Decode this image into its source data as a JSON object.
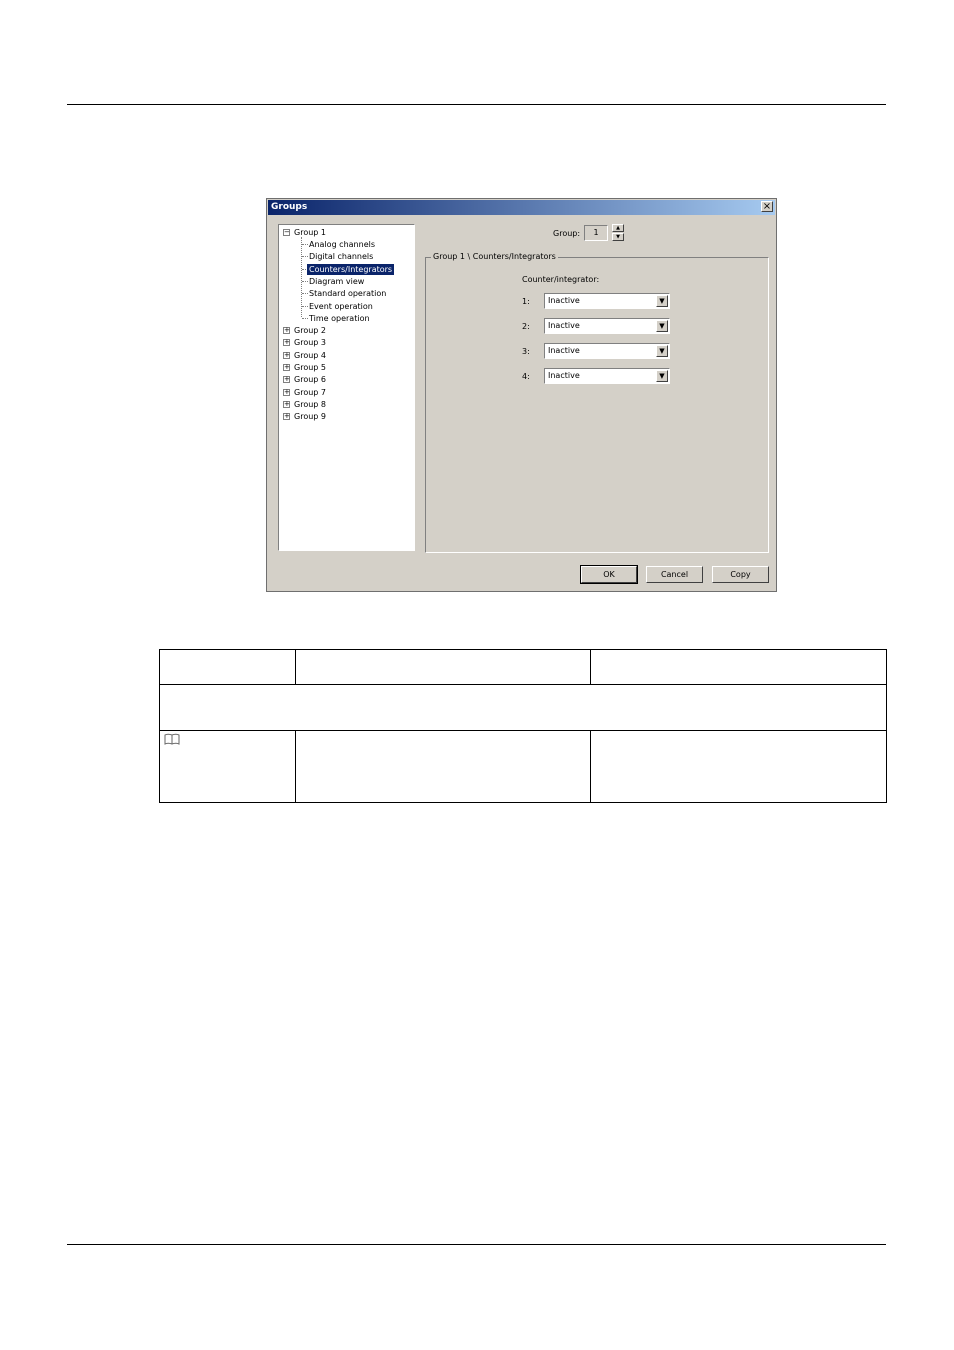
{
  "dialog": {
    "title": "Groups",
    "close_label": "×",
    "tree": {
      "root": "Group 1",
      "root_toggle": "−",
      "children": [
        "Analog channels",
        "Digital channels",
        "Counters/Integrators",
        "Diagram view",
        "Standard operation",
        "Event operation",
        "Time operation"
      ],
      "selected": "Counters/Integrators",
      "collapsed_toggle": "+",
      "groups": [
        "Group 2",
        "Group 3",
        "Group 4",
        "Group 5",
        "Group 6",
        "Group 7",
        "Group 8",
        "Group 9"
      ]
    },
    "group_selector": {
      "label": "Group:",
      "value": "1",
      "up": "▲",
      "down": "▼"
    },
    "panel": {
      "title": "Group 1 \\ Counters/Integrators",
      "counter_label": "Counter/integrator:",
      "rows": [
        {
          "label": "1:",
          "value": "Inactive"
        },
        {
          "label": "2:",
          "value": "Inactive"
        },
        {
          "label": "3:",
          "value": "Inactive"
        },
        {
          "label": "4:",
          "value": "Inactive"
        }
      ],
      "dropdown_arrow": "▼"
    },
    "buttons": {
      "ok": "OK",
      "cancel": "Cancel",
      "copy": "Copy"
    }
  }
}
